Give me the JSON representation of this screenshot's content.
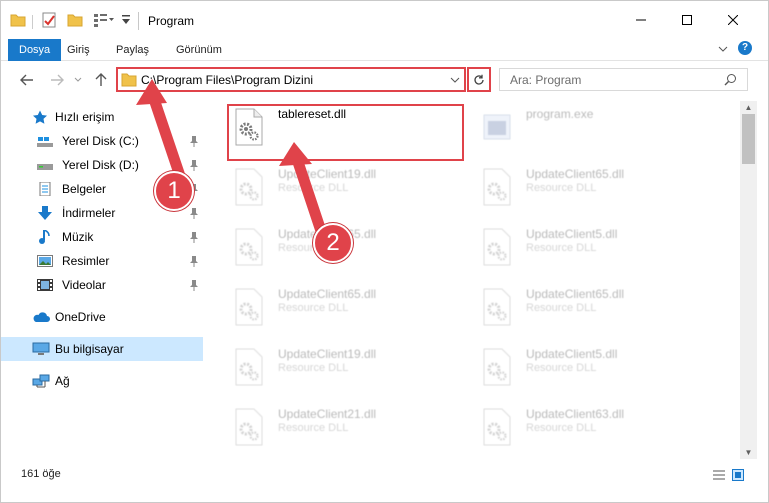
{
  "window": {
    "title": "Program",
    "colors": {
      "accent": "#1979ca",
      "annotation": "#e0434a",
      "selected_bg": "#cce8ff"
    }
  },
  "ribbon": {
    "tabs": [
      "Dosya",
      "Giriş",
      "Paylaş",
      "Görünüm"
    ]
  },
  "nav": {
    "address": "C:\\Program Files\\Program Dizini",
    "search_placeholder": "Ara: Program"
  },
  "sidebar": {
    "quick_access": "Hızlı erişim",
    "items": [
      {
        "label": "Yerel Disk (C:)",
        "icon": "drive-icon",
        "pinned": true
      },
      {
        "label": "Yerel Disk (D:)",
        "icon": "drive-icon",
        "pinned": true
      },
      {
        "label": "Belgeler",
        "icon": "documents-icon",
        "pinned": true
      },
      {
        "label": "İndirmeler",
        "icon": "download-icon",
        "pinned": true
      },
      {
        "label": "Müzik",
        "icon": "music-icon",
        "pinned": true
      },
      {
        "label": "Resimler",
        "icon": "pictures-icon",
        "pinned": true
      },
      {
        "label": "Videolar",
        "icon": "videos-icon",
        "pinned": true
      }
    ],
    "onedrive": "OneDrive",
    "this_pc": "Bu bilgisayar",
    "network": "Ağ"
  },
  "files": [
    {
      "name": "tablereset.dll",
      "type": "",
      "icon": "dll-gear-icon",
      "faded": false
    },
    {
      "name": "program.exe",
      "type": "",
      "icon": "exe-icon",
      "faded": true
    },
    {
      "name": "UpdateClient19.dll",
      "type": "Resource DLL",
      "faded": true
    },
    {
      "name": "UpdateClient65.dll",
      "type": "Resource DLL",
      "faded": true
    },
    {
      "name": "UpdateClient65.dll",
      "type": "Resource DLL",
      "faded": true
    },
    {
      "name": "UpdateClient5.dll",
      "type": "Resource DLL",
      "faded": true
    },
    {
      "name": "UpdateClient65.dll",
      "type": "Resource DLL",
      "faded": true
    },
    {
      "name": "UpdateClient65.dll",
      "type": "Resource DLL",
      "faded": true
    },
    {
      "name": "UpdateClient19.dll",
      "type": "Resource DLL",
      "faded": true
    },
    {
      "name": "UpdateClient5.dll",
      "type": "Resource DLL",
      "faded": true
    },
    {
      "name": "UpdateClient21.dll",
      "type": "Resource DLL",
      "faded": true
    },
    {
      "name": "UpdateClient63.dll",
      "type": "Resource DLL",
      "faded": true
    }
  ],
  "status": {
    "count_text": "161 öğe"
  },
  "annotations": {
    "step1": "1",
    "step2": "2"
  }
}
